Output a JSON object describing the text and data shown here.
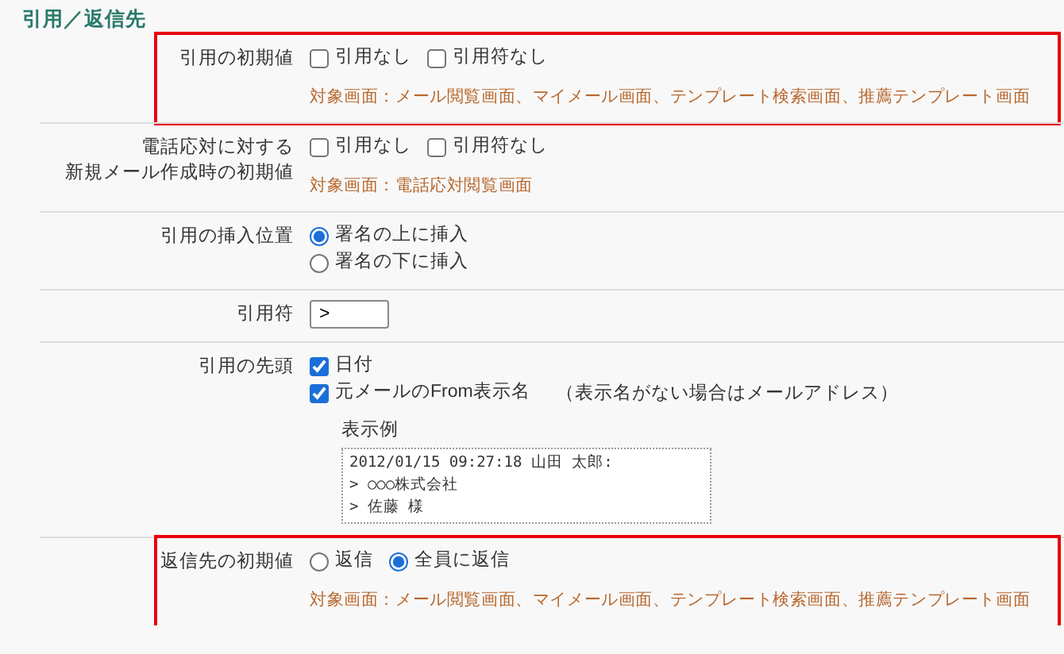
{
  "section": {
    "title": "引用／返信先"
  },
  "rows": [
    {
      "kind": "checkboxes",
      "highlighted": true,
      "label": [
        "引用の初期値"
      ],
      "options": [
        {
          "label": "引用なし",
          "checked": false
        },
        {
          "label": "引用符なし",
          "checked": false
        }
      ],
      "note": "対象画面：メール閲覧画面、マイメール画面、テンプレート検索画面、推薦テンプレート画面"
    },
    {
      "kind": "checkboxes",
      "highlighted": false,
      "label": [
        "電話応対に対する",
        "新規メール作成時の初期値"
      ],
      "options": [
        {
          "label": "引用なし",
          "checked": false
        },
        {
          "label": "引用符なし",
          "checked": false
        }
      ],
      "note": "対象画面：電話応対閲覧画面"
    },
    {
      "kind": "radios",
      "highlighted": false,
      "label": [
        "引用の挿入位置"
      ],
      "options": [
        {
          "label": "署名の上に挿入",
          "selected": true
        },
        {
          "label": "署名の下に挿入",
          "selected": false
        }
      ]
    },
    {
      "kind": "input",
      "highlighted": false,
      "label": [
        "引用符"
      ],
      "value": ">"
    },
    {
      "kind": "checkboxes",
      "highlighted": false,
      "label": [
        "引用の先頭"
      ],
      "options": [
        {
          "label": "日付",
          "checked": true
        },
        {
          "label": "元メールのFrom表示名",
          "checked": true,
          "hint": "（表示名がない場合はメールアドレス）"
        }
      ],
      "preview": {
        "title": "表示例",
        "lines": [
          "2012/01/15 09:27:18 山田 太郎:",
          "> ○○○株式会社",
          "> 佐藤 様"
        ]
      }
    },
    {
      "kind": "radios",
      "highlighted": true,
      "label": [
        "返信先の初期値"
      ],
      "options": [
        {
          "label": "返信",
          "selected": false
        },
        {
          "label": "全員に返信",
          "selected": true
        }
      ],
      "note": "対象画面：メール閲覧画面、マイメール画面、テンプレート検索画面、推薦テンプレート画面"
    }
  ]
}
